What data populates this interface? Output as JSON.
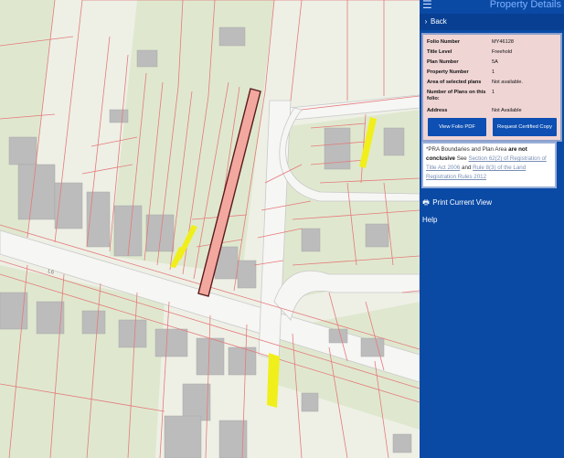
{
  "panel": {
    "menu_icon": "menu-icon",
    "title": "Property Details",
    "back_label": "Back"
  },
  "details": {
    "rows": [
      {
        "label": "Folio Number",
        "value": "MY46128"
      },
      {
        "label": "Title Level",
        "value": "Freehold"
      },
      {
        "label": "Plan Number",
        "value": "5A"
      },
      {
        "label": "Property Number",
        "value": "1"
      },
      {
        "label": "Area of selected plans",
        "value": "Not available."
      },
      {
        "label": "Number of Plans on this folio:",
        "value": "1"
      },
      {
        "label": "Address",
        "value": "Not Available"
      }
    ],
    "view_pdf_label": "View Folio PDF",
    "certified_copy_label": "Request Certified Copy"
  },
  "note": {
    "prefix": "*PRA Boundaries and Plan Area",
    "bold": "are not conclusive",
    "see": "See",
    "link1": "Section 62(2) of Registration of Title Act 2006",
    "and": "and",
    "link2": "Rule 8(3) of the Land Registration Rules 2012"
  },
  "links": {
    "print_label": "Print Current View",
    "help_label": "Help"
  },
  "map": {
    "road_label": "L6",
    "colors": {
      "background": "#eef0e6",
      "boundary": "#e57a7a",
      "selected_fill": "#f2a79f",
      "highlight": "#f0ef1c",
      "building": "#bdbdbd",
      "road": "#f5f5f5"
    }
  }
}
